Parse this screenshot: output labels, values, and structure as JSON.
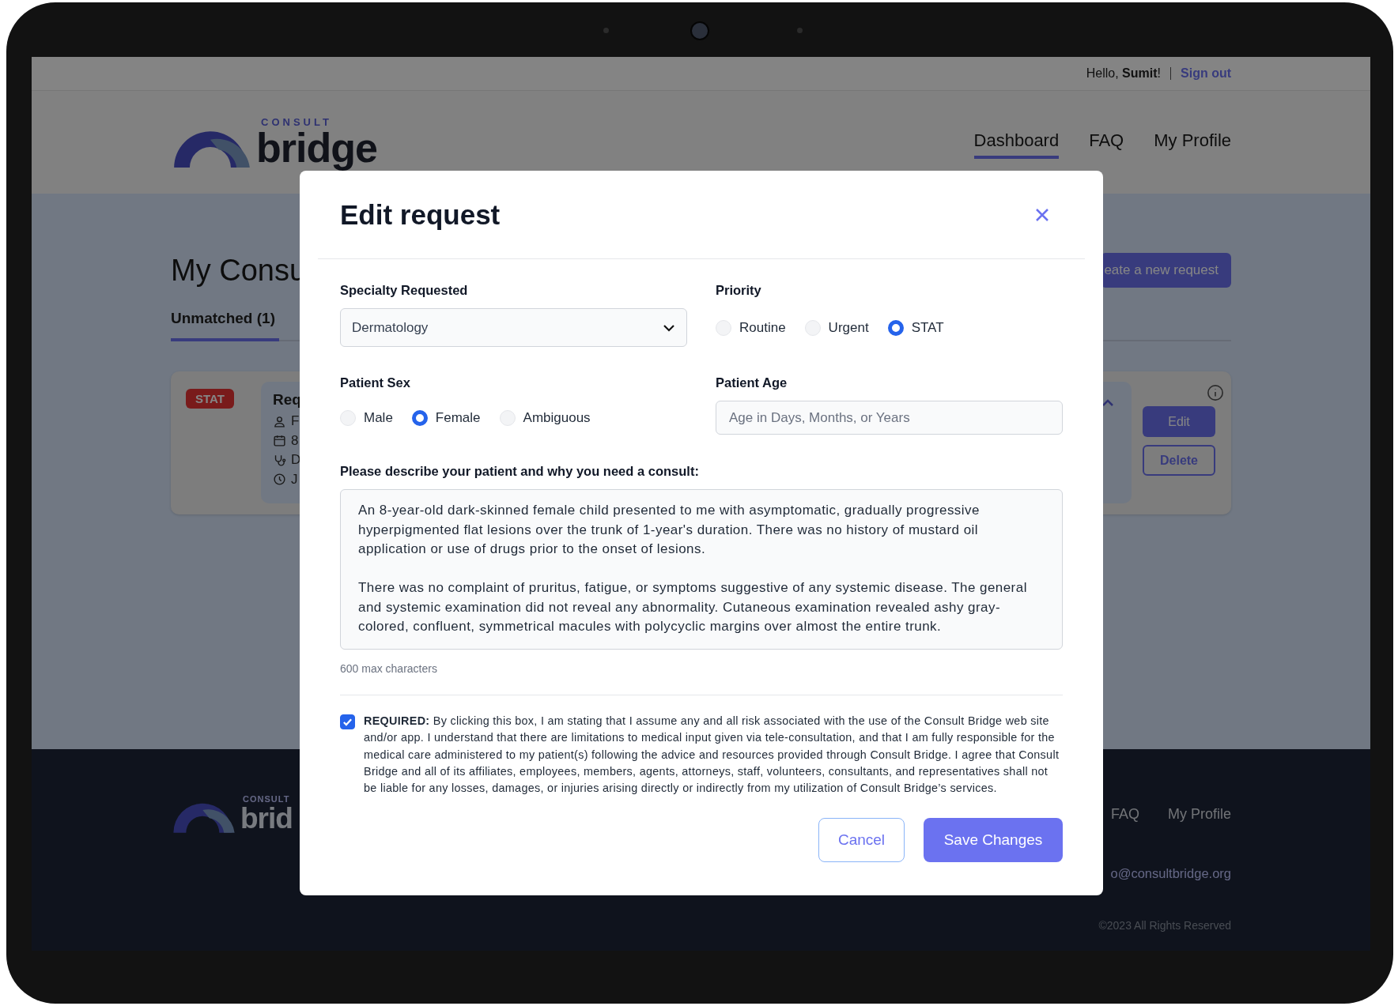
{
  "top_bar": {
    "greeting": "Hello, **Sumit**!",
    "sign_out": "Sign out"
  },
  "header": {
    "logo": {
      "small": "CONSULT",
      "big": "bridge"
    },
    "nav": [
      {
        "label": "Dashboard",
        "selected": true
      },
      {
        "label": "FAQ",
        "selected": false
      },
      {
        "label": "My Profile",
        "selected": false
      }
    ]
  },
  "main": {
    "title": "My Consu",
    "create_button": "eate a new request",
    "tabs": [
      {
        "label": "Unmatched (1)",
        "selected": true
      }
    ],
    "card": {
      "badge": "STAT",
      "request_title": "Req",
      "details": [
        {
          "kind": "person",
          "text": "F"
        },
        {
          "kind": "calendar",
          "text": "8"
        },
        {
          "kind": "stethoscope",
          "text": "D"
        },
        {
          "kind": "clock",
          "text": "J"
        }
      ],
      "edit": "Edit",
      "delete": "Delete"
    }
  },
  "footer": {
    "logo": {
      "small": "CONSULT",
      "big": "brid"
    },
    "links": [
      "FAQ",
      "My Profile"
    ],
    "email": "o@consultbridge.org",
    "copyright": "©2023 All Rights Reserved"
  },
  "modal": {
    "title": "Edit request",
    "specialty": {
      "label": "Specialty Requested",
      "value": "Dermatology"
    },
    "priority": {
      "label": "Priority",
      "options": [
        {
          "label": "Routine",
          "selected": false
        },
        {
          "label": "Urgent",
          "selected": false
        },
        {
          "label": "STAT",
          "selected": true
        }
      ]
    },
    "sex": {
      "label": "Patient Sex",
      "options": [
        {
          "label": "Male",
          "selected": false
        },
        {
          "label": "Female",
          "selected": true
        },
        {
          "label": "Ambiguous",
          "selected": false
        }
      ]
    },
    "age": {
      "label": "Patient Age",
      "placeholder": "Age in Days, Months, or Years"
    },
    "description": {
      "label": "Please describe your patient and why you need a consult:",
      "value": "An 8-year-old dark-skinned female child presented to me with asymptomatic, gradually progressive hyperpigmented flat lesions over the trunk of 1-year's duration. There was no history of mustard oil application or use of drugs prior to the onset of lesions.\n\nThere was no complaint of pruritus, fatigue, or symptoms suggestive of any systemic disease. The general and systemic examination did not reveal any abnormality. Cutaneous examination revealed ashy gray-colored, confluent, symmetrical macules with polycyclic margins over almost the entire trunk.",
      "hint": "600 max characters"
    },
    "agreement": {
      "checked": true,
      "text": "**REQUIRED:** By clicking this box, I am stating that I assume any and all risk associated with the use of the Consult Bridge web site and/or app. I understand that there are limitations to medical input given via tele-consultation, and that I am fully responsible for the medical care administered to my patient(s) following the advice and resources provided through Consult Bridge. I agree that Consult Bridge and all of its affiliates, employees, members, agents, attorneys, staff, volunteers, consultants, and representatives shall not be liable for any losses, damages, or injuries arising directly or indirectly from my utilization of Consult Bridge’s services."
    },
    "buttons": {
      "cancel": "Cancel",
      "save": "Save Changes"
    }
  }
}
